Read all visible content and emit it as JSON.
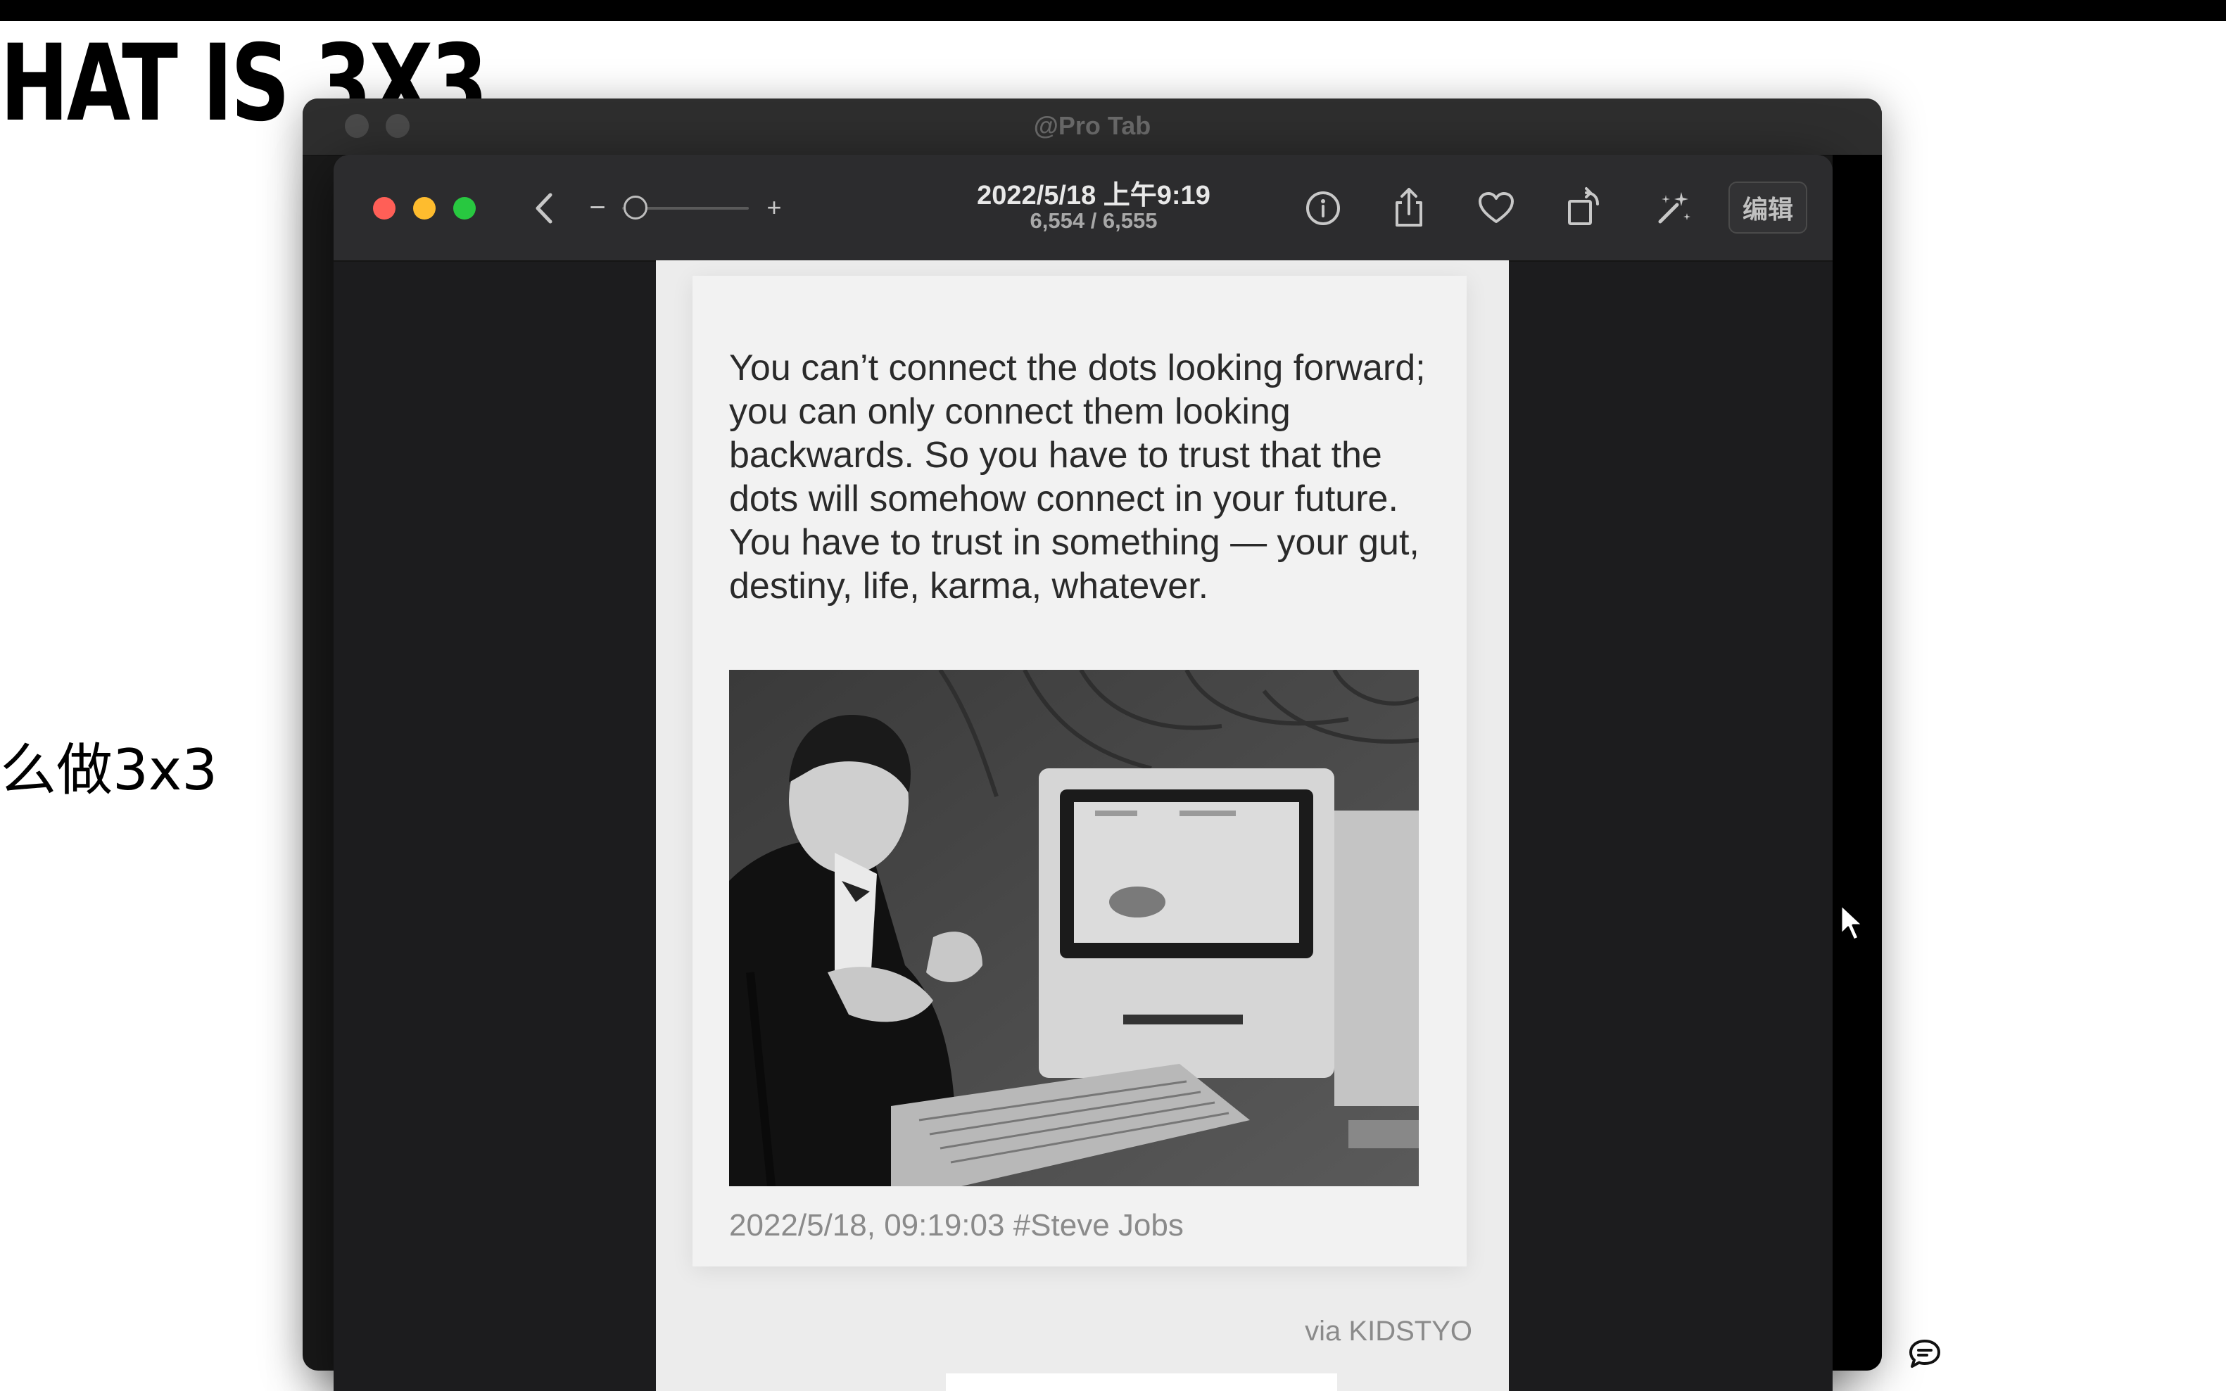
{
  "slide": {
    "title": "HAT IS 3X3",
    "subtitle": "么做3x3"
  },
  "background_window": {
    "title": "@Pro Tab"
  },
  "viewer": {
    "toolbar": {
      "date_time": "2022/5/18 上午9:19",
      "position": "6,554 / 6,555",
      "edit_label": "编辑",
      "zoom_minus": "−",
      "zoom_plus": "+"
    },
    "photo": {
      "quote": "You can’t connect the dots looking forward; you can only connect them looking backwards. So you have to trust that the dots will somehow connect in your future. You have to trust in something — your gut, destiny, life, karma, whatever.",
      "caption": "2022/5/18, 09:19:03  #Steve Jobs",
      "via": "via KIDSTYO"
    }
  },
  "colors": {
    "close": "#ff5f57",
    "minimize": "#febc2e",
    "zoom": "#28c840",
    "toolbar_bg": "#2c2c2e",
    "viewer_bg": "#1c1c1e"
  },
  "icons": [
    "back-chevron-icon",
    "info-icon",
    "share-icon",
    "heart-icon",
    "rotate-icon",
    "enhance-icon",
    "cursor-icon",
    "comment-icon"
  ]
}
